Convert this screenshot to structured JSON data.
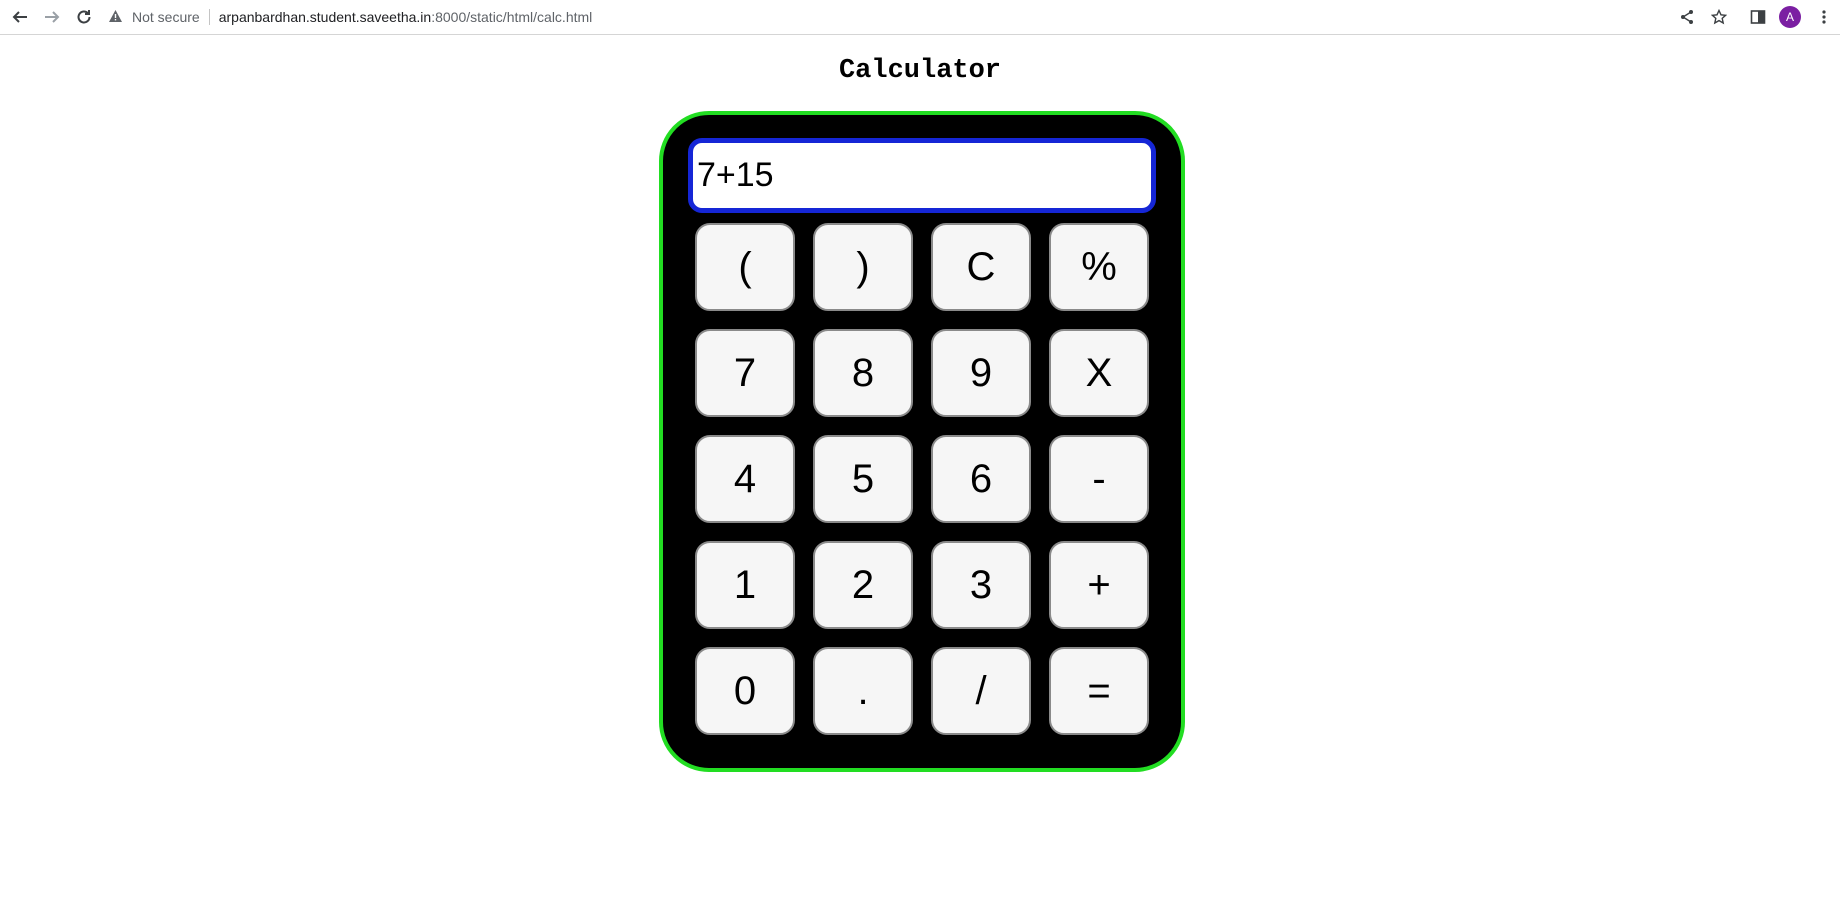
{
  "browser": {
    "security_label": "Not secure",
    "url_host": "arpanbardhan.student.saveetha.in",
    "url_path": ":8000/static/html/calc.html",
    "avatar_letter": "A",
    "avatar_color": "#7b1fa2",
    "icons": [
      "back-icon",
      "forward-icon",
      "reload-icon",
      "warning-icon",
      "share-icon",
      "star-icon",
      "side-panel-icon",
      "menu-icon"
    ]
  },
  "page": {
    "title": "Calculator"
  },
  "calculator": {
    "display_value": "7+15",
    "body_color": "#000000",
    "border_color": "#22dd22",
    "display_border_color": "#1526d6",
    "keys": [
      [
        "(",
        ")",
        "C",
        "%"
      ],
      [
        "7",
        "8",
        "9",
        "X"
      ],
      [
        "4",
        "5",
        "6",
        "-"
      ],
      [
        "1",
        "2",
        "3",
        "+"
      ],
      [
        "0",
        ".",
        "/",
        "="
      ]
    ]
  }
}
